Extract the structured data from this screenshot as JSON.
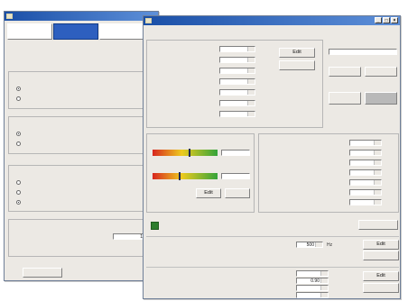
{
  "back_window": {
    "title": "",
    "steps": [
      {
        "label": ""
      },
      {
        "label": ""
      },
      {
        "label": ""
      }
    ],
    "headline1": "",
    "headline2": "",
    "group_machine_control": {
      "label": "",
      "prompt": "",
      "options": [
        "",
        ""
      ]
    },
    "group_offset_load": {
      "label": "",
      "prompt": "",
      "options": [
        "",
        ""
      ]
    },
    "group_rigidity": {
      "label": "",
      "prompt": "",
      "options": [
        "",
        "",
        ""
      ]
    },
    "group_accuracy": {
      "label": "",
      "prompt": "",
      "field_label": "",
      "value": "1.00",
      "range": ""
    },
    "next_button": ""
  },
  "front_window": {
    "title": "",
    "amp_label": "",
    "amp_value": "",
    "amp_id": "",
    "group_operation": {
      "label": "",
      "rows": [
        {
          "label": "",
          "value": "",
          "unit": ""
        },
        {
          "label": "",
          "value": "",
          "unit": ""
        },
        {
          "label": "",
          "value": "",
          "unit": ""
        },
        {
          "label": "",
          "value": "",
          "unit": ""
        },
        {
          "label": "",
          "value": "",
          "unit": ""
        },
        {
          "label": "",
          "value": "",
          "unit": ""
        },
        {
          "label": "",
          "value": "",
          "unit": ""
        }
      ],
      "edit_button": "Edit",
      "cancel_button": ""
    },
    "right_panel": {
      "label1": "",
      "label2": "",
      "btn_on": "",
      "btn_off": "",
      "label3": "",
      "btn_start": "",
      "btn_stop": ""
    },
    "group_basic": {
      "label": "",
      "gauge1_label": "",
      "gauge1_fill": 0.55,
      "gauge2_label": "",
      "gauge2_fill": 0.4,
      "edit_button": "Edit",
      "cancel_button": ""
    },
    "group_gain": {
      "label": "",
      "rows": [
        {
          "label": "",
          "value": "",
          "unit": ""
        },
        {
          "label": "",
          "value": "",
          "unit": ""
        },
        {
          "label": "",
          "value": "",
          "unit": ""
        },
        {
          "label": "",
          "value": "",
          "unit": ""
        },
        {
          "label": "",
          "value": "",
          "unit": ""
        },
        {
          "label": "",
          "value": "",
          "unit": ""
        },
        {
          "label": "",
          "value": "",
          "unit": ""
        }
      ]
    },
    "adjust_label": "",
    "check_text1": "",
    "check_text2": "",
    "operation_button": "",
    "freq_row": {
      "label": "",
      "value": "500",
      "unit": "Hz",
      "edit_button": "Edit",
      "cancel_button": ""
    },
    "vib_rows": [
      {
        "label": "",
        "value": ""
      },
      {
        "label": "",
        "value": "0.90",
        "unit": ""
      },
      {
        "label": "",
        "value": "",
        "unit": ""
      },
      {
        "label": "",
        "value": "",
        "unit": ""
      }
    ],
    "vib_edit_button": "Edit",
    "vib_cancel_button": ""
  }
}
